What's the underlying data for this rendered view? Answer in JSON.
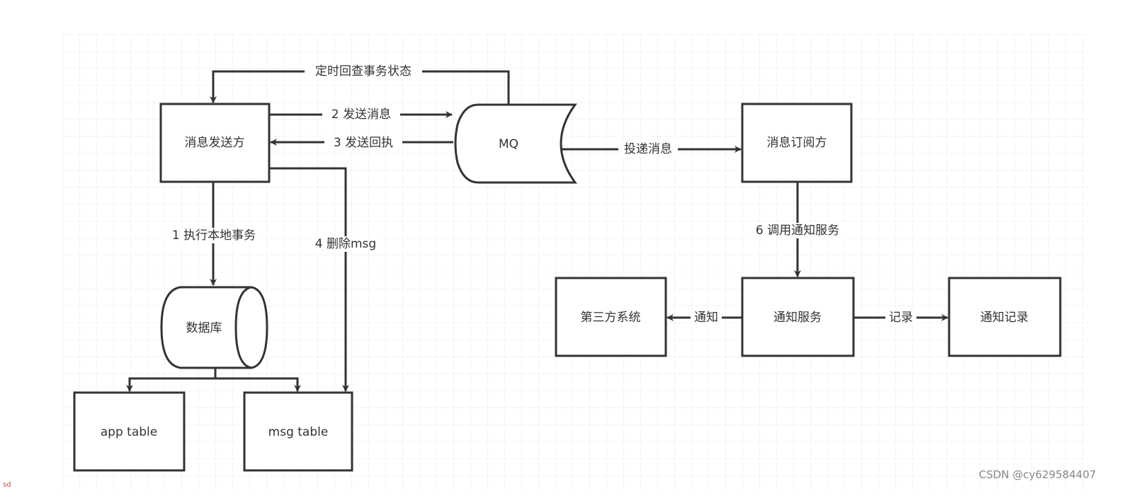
{
  "nodes": {
    "sender": "消息发送方",
    "mq": "MQ",
    "subscriber": "消息订阅方",
    "database": "数据库",
    "app_table": "app table",
    "msg_table": "msg table",
    "notify_service": "通知服务",
    "third_party": "第三方系统",
    "notify_record": "通知记录"
  },
  "edges": {
    "check_status": "定时回查事务状态",
    "send_msg": "2 发送消息",
    "send_receipt": "3 发送回执",
    "deliver": "投递消息",
    "local_tx": "1 执行本地事务",
    "delete_msg": "4 删除msg",
    "call_notify": "6 调用通知服务",
    "notify": "通知",
    "record": "记录"
  },
  "footer": {
    "corner_text": "sd",
    "watermark": "CSDN @cy629584407"
  },
  "colors": {
    "stroke": "#333333",
    "grid": "#e8e8e8"
  }
}
